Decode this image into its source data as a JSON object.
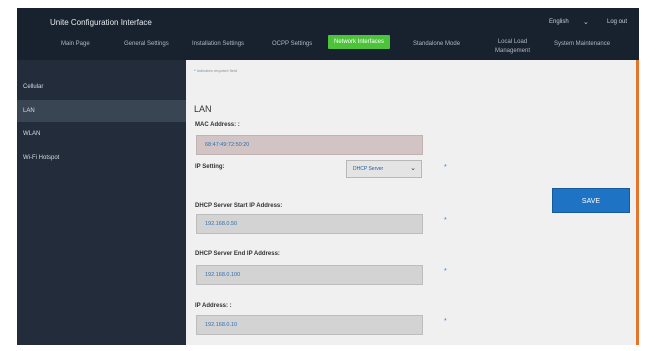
{
  "app": {
    "title": "Unite Configuration Interface",
    "language": "English",
    "logout": "Log out"
  },
  "nav": {
    "main_page": "Main Page",
    "general_settings": "General Settings",
    "installation_settings": "Installation Settings",
    "ocpp_settings": "OCPP Settings",
    "network_interfaces": "Network Interfaces",
    "standalone_mode": "Standalone Mode",
    "local_load_management_line1": "Local Load",
    "local_load_management_line2": "Management",
    "system_maintenance": "System Maintenance"
  },
  "sidebar": {
    "items": [
      {
        "label": "Cellular"
      },
      {
        "label": "LAN"
      },
      {
        "label": "WLAN"
      },
      {
        "label": "Wi-Fi Hotspot"
      }
    ]
  },
  "form": {
    "required_star": "*",
    "required_note": "Indicates required field",
    "section_title": "LAN",
    "mac_label": "MAC Address: :",
    "mac_value": "68:47:49:72:50:20",
    "ip_setting_label": "IP Setting:",
    "ip_setting_value": "DHCP Server",
    "dhcp_start_label": "DHCP Server Start IP Address:",
    "dhcp_start_value": "192.168.0.50",
    "dhcp_end_label": "DHCP Server End IP Address:",
    "dhcp_end_value": "192.168.0.100",
    "ip_label": "IP Address: :",
    "ip_value": "192.168.0.10",
    "save_label": "SAVE"
  },
  "colors": {
    "topbar": "#18222e",
    "sidebar": "#222c3a",
    "active_nav": "#4cc33a",
    "save_button": "#1f73c4",
    "accent_bar": "#e8742a"
  }
}
